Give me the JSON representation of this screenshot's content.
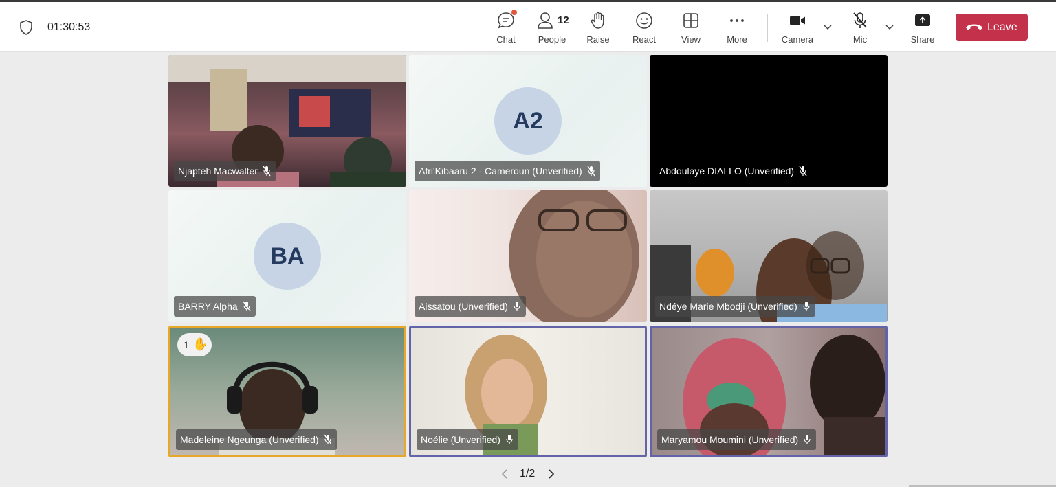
{
  "header": {
    "timer": "01:30:53",
    "toolbar": {
      "chat": "Chat",
      "people": "People",
      "people_count": "12",
      "raise": "Raise",
      "react": "React",
      "view": "View",
      "more": "More",
      "camera": "Camera",
      "mic": "Mic",
      "share": "Share",
      "leave": "Leave"
    }
  },
  "tiles": [
    {
      "name": "Njapteh Macwalter"
    },
    {
      "name": "Afri'Kibaaru 2 - Cameroun (Unverified)",
      "initials": "A2"
    },
    {
      "name": "Abdoulaye DIALLO (Unverified)"
    },
    {
      "name": "BARRY Alpha",
      "initials": "BA"
    },
    {
      "name": "Aissatou (Unverified)"
    },
    {
      "name": "Ndéye Marie Mbodji (Unverified)"
    },
    {
      "name": "Madeleine Ngeunga (Unverified)",
      "raised": "1"
    },
    {
      "name": "Noélie (Unverified)"
    },
    {
      "name": "Maryamou Moumini (Unverified)"
    }
  ],
  "pager": {
    "text": "1/2"
  },
  "colors": {
    "leave": "#c4314b",
    "speaking_highlight": "#6264a7",
    "raised_highlight": "#e7a82a",
    "avatar": "#c6d4e6"
  }
}
